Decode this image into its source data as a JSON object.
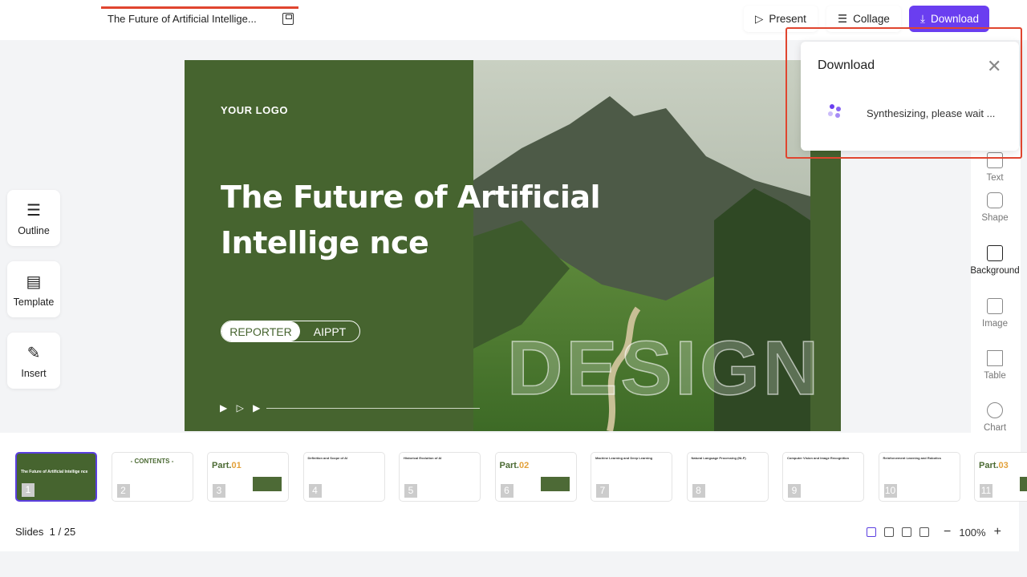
{
  "header": {
    "doc_title": "The Future of Artificial Intellige...",
    "present": "Present",
    "collage": "Collage",
    "download": "Download"
  },
  "left_tools": [
    {
      "label": "Outline",
      "icon": "outline-icon"
    },
    {
      "label": "Template",
      "icon": "template-icon"
    },
    {
      "label": "Insert",
      "icon": "insert-icon"
    }
  ],
  "right_tools": [
    {
      "label": "Text"
    },
    {
      "label": "Shape"
    },
    {
      "label": "Background"
    },
    {
      "label": "Image"
    },
    {
      "label": "Table"
    },
    {
      "label": "Chart"
    }
  ],
  "slide": {
    "logo": "YOUR LOGO",
    "title": "The Future of Artificial Intellige nce",
    "reporter": "REPORTER",
    "name": "AIPPT",
    "watermark": "DESIGN",
    "arrows": "▶ ▷ ▶"
  },
  "download_popup": {
    "title": "Download",
    "message": "Synthesizing, please wait ...",
    "accent": "#6a3ef0",
    "highlight": "#e0452f"
  },
  "thumbnails": [
    {
      "num": "1",
      "title": "The Future of Artificial Intellige nce",
      "kind": "cover"
    },
    {
      "num": "2",
      "title": "- CONTENTS -",
      "kind": "contents"
    },
    {
      "num": "3",
      "part": "Part.",
      "partnum": "01",
      "kind": "part"
    },
    {
      "num": "4",
      "title": "Definition and Scope of AI",
      "kind": "content"
    },
    {
      "num": "5",
      "title": "Historical Evolution of AI",
      "kind": "content"
    },
    {
      "num": "6",
      "part": "Part.",
      "partnum": "02",
      "kind": "part"
    },
    {
      "num": "7",
      "title": "Machine Learning and Deep Learning",
      "kind": "content"
    },
    {
      "num": "8",
      "title": "Natural Language Processing (NLP)",
      "kind": "content"
    },
    {
      "num": "9",
      "title": "Computer Vision and Image Recognition",
      "kind": "content"
    },
    {
      "num": "10",
      "title": "Reinforcement Learning and Robotics",
      "kind": "content"
    },
    {
      "num": "11",
      "part": "Part.",
      "partnum": "03",
      "kind": "part"
    }
  ],
  "footer": {
    "slides_label": "Slides",
    "current": "1 / 25",
    "zoom": "100%",
    "minus": "−",
    "plus": "+"
  }
}
